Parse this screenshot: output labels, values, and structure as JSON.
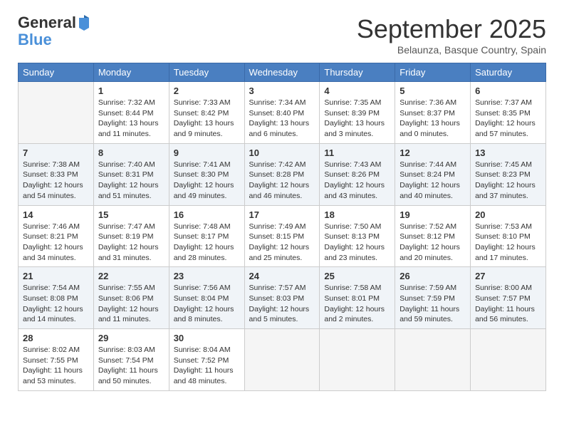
{
  "header": {
    "logo_line1": "General",
    "logo_line2": "Blue",
    "month": "September 2025",
    "location": "Belaunza, Basque Country, Spain"
  },
  "weekdays": [
    "Sunday",
    "Monday",
    "Tuesday",
    "Wednesday",
    "Thursday",
    "Friday",
    "Saturday"
  ],
  "weeks": [
    [
      {
        "day": "",
        "info": ""
      },
      {
        "day": "1",
        "info": "Sunrise: 7:32 AM\nSunset: 8:44 PM\nDaylight: 13 hours\nand 11 minutes."
      },
      {
        "day": "2",
        "info": "Sunrise: 7:33 AM\nSunset: 8:42 PM\nDaylight: 13 hours\nand 9 minutes."
      },
      {
        "day": "3",
        "info": "Sunrise: 7:34 AM\nSunset: 8:40 PM\nDaylight: 13 hours\nand 6 minutes."
      },
      {
        "day": "4",
        "info": "Sunrise: 7:35 AM\nSunset: 8:39 PM\nDaylight: 13 hours\nand 3 minutes."
      },
      {
        "day": "5",
        "info": "Sunrise: 7:36 AM\nSunset: 8:37 PM\nDaylight: 13 hours\nand 0 minutes."
      },
      {
        "day": "6",
        "info": "Sunrise: 7:37 AM\nSunset: 8:35 PM\nDaylight: 12 hours\nand 57 minutes."
      }
    ],
    [
      {
        "day": "7",
        "info": "Sunrise: 7:38 AM\nSunset: 8:33 PM\nDaylight: 12 hours\nand 54 minutes."
      },
      {
        "day": "8",
        "info": "Sunrise: 7:40 AM\nSunset: 8:31 PM\nDaylight: 12 hours\nand 51 minutes."
      },
      {
        "day": "9",
        "info": "Sunrise: 7:41 AM\nSunset: 8:30 PM\nDaylight: 12 hours\nand 49 minutes."
      },
      {
        "day": "10",
        "info": "Sunrise: 7:42 AM\nSunset: 8:28 PM\nDaylight: 12 hours\nand 46 minutes."
      },
      {
        "day": "11",
        "info": "Sunrise: 7:43 AM\nSunset: 8:26 PM\nDaylight: 12 hours\nand 43 minutes."
      },
      {
        "day": "12",
        "info": "Sunrise: 7:44 AM\nSunset: 8:24 PM\nDaylight: 12 hours\nand 40 minutes."
      },
      {
        "day": "13",
        "info": "Sunrise: 7:45 AM\nSunset: 8:23 PM\nDaylight: 12 hours\nand 37 minutes."
      }
    ],
    [
      {
        "day": "14",
        "info": "Sunrise: 7:46 AM\nSunset: 8:21 PM\nDaylight: 12 hours\nand 34 minutes."
      },
      {
        "day": "15",
        "info": "Sunrise: 7:47 AM\nSunset: 8:19 PM\nDaylight: 12 hours\nand 31 minutes."
      },
      {
        "day": "16",
        "info": "Sunrise: 7:48 AM\nSunset: 8:17 PM\nDaylight: 12 hours\nand 28 minutes."
      },
      {
        "day": "17",
        "info": "Sunrise: 7:49 AM\nSunset: 8:15 PM\nDaylight: 12 hours\nand 25 minutes."
      },
      {
        "day": "18",
        "info": "Sunrise: 7:50 AM\nSunset: 8:13 PM\nDaylight: 12 hours\nand 23 minutes."
      },
      {
        "day": "19",
        "info": "Sunrise: 7:52 AM\nSunset: 8:12 PM\nDaylight: 12 hours\nand 20 minutes."
      },
      {
        "day": "20",
        "info": "Sunrise: 7:53 AM\nSunset: 8:10 PM\nDaylight: 12 hours\nand 17 minutes."
      }
    ],
    [
      {
        "day": "21",
        "info": "Sunrise: 7:54 AM\nSunset: 8:08 PM\nDaylight: 12 hours\nand 14 minutes."
      },
      {
        "day": "22",
        "info": "Sunrise: 7:55 AM\nSunset: 8:06 PM\nDaylight: 12 hours\nand 11 minutes."
      },
      {
        "day": "23",
        "info": "Sunrise: 7:56 AM\nSunset: 8:04 PM\nDaylight: 12 hours\nand 8 minutes."
      },
      {
        "day": "24",
        "info": "Sunrise: 7:57 AM\nSunset: 8:03 PM\nDaylight: 12 hours\nand 5 minutes."
      },
      {
        "day": "25",
        "info": "Sunrise: 7:58 AM\nSunset: 8:01 PM\nDaylight: 12 hours\nand 2 minutes."
      },
      {
        "day": "26",
        "info": "Sunrise: 7:59 AM\nSunset: 7:59 PM\nDaylight: 11 hours\nand 59 minutes."
      },
      {
        "day": "27",
        "info": "Sunrise: 8:00 AM\nSunset: 7:57 PM\nDaylight: 11 hours\nand 56 minutes."
      }
    ],
    [
      {
        "day": "28",
        "info": "Sunrise: 8:02 AM\nSunset: 7:55 PM\nDaylight: 11 hours\nand 53 minutes."
      },
      {
        "day": "29",
        "info": "Sunrise: 8:03 AM\nSunset: 7:54 PM\nDaylight: 11 hours\nand 50 minutes."
      },
      {
        "day": "30",
        "info": "Sunrise: 8:04 AM\nSunset: 7:52 PM\nDaylight: 11 hours\nand 48 minutes."
      },
      {
        "day": "",
        "info": ""
      },
      {
        "day": "",
        "info": ""
      },
      {
        "day": "",
        "info": ""
      },
      {
        "day": "",
        "info": ""
      }
    ]
  ]
}
